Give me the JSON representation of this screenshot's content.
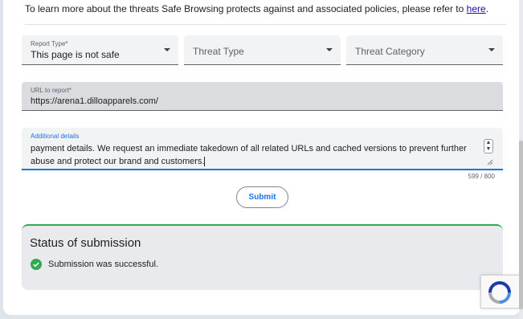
{
  "intro": {
    "text": "To learn more about the threats Safe Browsing protects against and associated policies, please refer to ",
    "link": "here",
    "suffix": "."
  },
  "form": {
    "report_type": {
      "label": "Report Type*",
      "value": "This page is not safe"
    },
    "threat_type": {
      "placeholder": "Threat Type"
    },
    "threat_category": {
      "placeholder": "Threat Category"
    },
    "url": {
      "label": "URL to report*",
      "value": "https://arena1.dilloapparels.com/"
    },
    "details": {
      "label": "Additional details",
      "value": "payment details. We request an immediate takedown of all related URLs and cached versions to prevent further abuse and protect our brand and customers.",
      "counter": "599 / 800"
    },
    "submit_label": "Submit"
  },
  "status": {
    "title": "Status of submission",
    "message": "Submission was successful."
  },
  "colors": {
    "accent": "#1a73e8",
    "success": "#34a853",
    "link": "#1a0dab"
  },
  "icons": [
    "chevron-down-icon",
    "check-circle-icon",
    "spinner-arrows-icon",
    "resize-grip-icon",
    "recaptcha-icon"
  ]
}
